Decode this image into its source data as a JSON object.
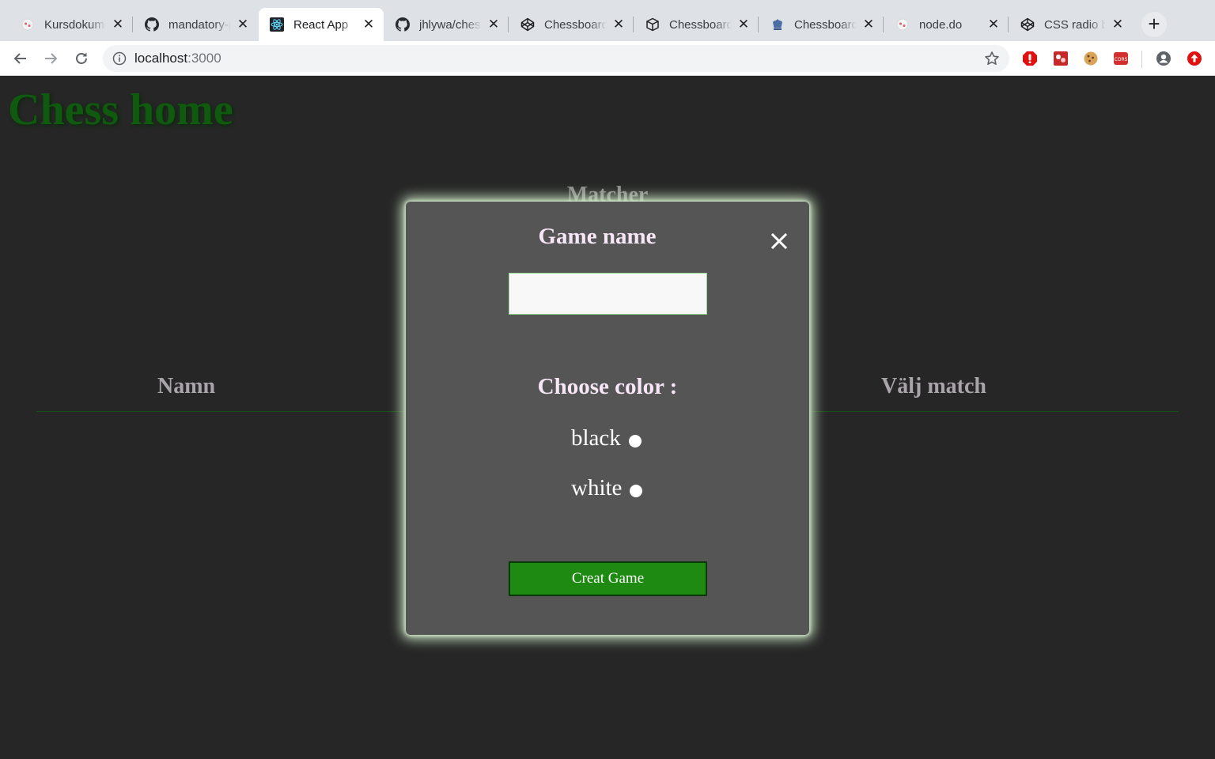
{
  "browser": {
    "tabs": [
      {
        "title": "Kursdokume",
        "icon": "ball-favicon",
        "active": false
      },
      {
        "title": "mandatory-p",
        "icon": "github-favicon",
        "active": false
      },
      {
        "title": "React App",
        "icon": "react-favicon",
        "active": true
      },
      {
        "title": "jhlywa/chess",
        "icon": "github-favicon",
        "active": false
      },
      {
        "title": "Chessboard",
        "icon": "codepen-favicon",
        "active": false
      },
      {
        "title": "Chessboard",
        "icon": "codepen-favicon",
        "active": false
      },
      {
        "title": "Chessboard",
        "icon": "chess-favicon",
        "active": false
      },
      {
        "title": "node.do",
        "icon": "ball-favicon",
        "active": false
      },
      {
        "title": "CSS radio b",
        "icon": "codepen-favicon",
        "active": false
      }
    ],
    "url_host": "localhost",
    "url_port": ":3000"
  },
  "page": {
    "title": "Chess home",
    "matches_title": "Matcher",
    "columns": {
      "name": "Namn",
      "choose": "Välj match"
    }
  },
  "modal": {
    "title": "Game name",
    "input_value": "",
    "choose_color_label": "Choose color :",
    "options": [
      {
        "label": "black"
      },
      {
        "label": "white"
      }
    ],
    "create_label": "Creat Game"
  },
  "colors": {
    "page_bg": "#262626",
    "title_green": "#0f5a0f",
    "modal_bg": "#555555",
    "button_green": "#1f8a12"
  }
}
